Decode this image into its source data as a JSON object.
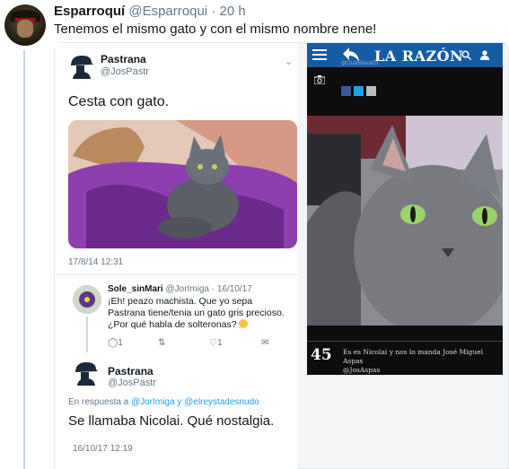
{
  "tweet": {
    "author_name": "Esparroquí",
    "author_handle": "@Esparroqui",
    "separator": "·",
    "time": "20 h",
    "text": "Tenemos el mismo gato y con el mismo nombre nene!"
  },
  "left_screenshot": {
    "original": {
      "author_name": "Pastrana",
      "author_handle": "@JosPastr",
      "text": "Cesta con gato.",
      "date": "17/8/14 12:31"
    },
    "reply": {
      "author_name": "Sole_sinMari",
      "author_handle": "@JorImiga",
      "date": "· 16/10/17",
      "text": "¡Eh! peazo machista. Que yo sepa Pastrana tiene/tenia un gato gris precioso. ¿Por qué habla de solteronas?",
      "retweet_count": "",
      "like_count": "1",
      "reply_count": "1"
    },
    "answer": {
      "author_name": "Pastrana",
      "author_handle": "@JosPastr",
      "in_reply_prefix": "En respuesta a",
      "mention1": "@JorImiga",
      "joiner": "y",
      "mention2": "@elreystadesnudo",
      "text": "Se llamaba Nicolai. Qué nostalgia.",
      "date": "16/10/17 12:19"
    }
  },
  "right_screenshot": {
    "brand": "LA RAZÓN",
    "byline": "@Guardiesalco",
    "caption_number": "45",
    "caption_text": "Es es Nicolai y nos lo manda José Miguel Aspas",
    "caption_handle": "@JosAspas"
  }
}
